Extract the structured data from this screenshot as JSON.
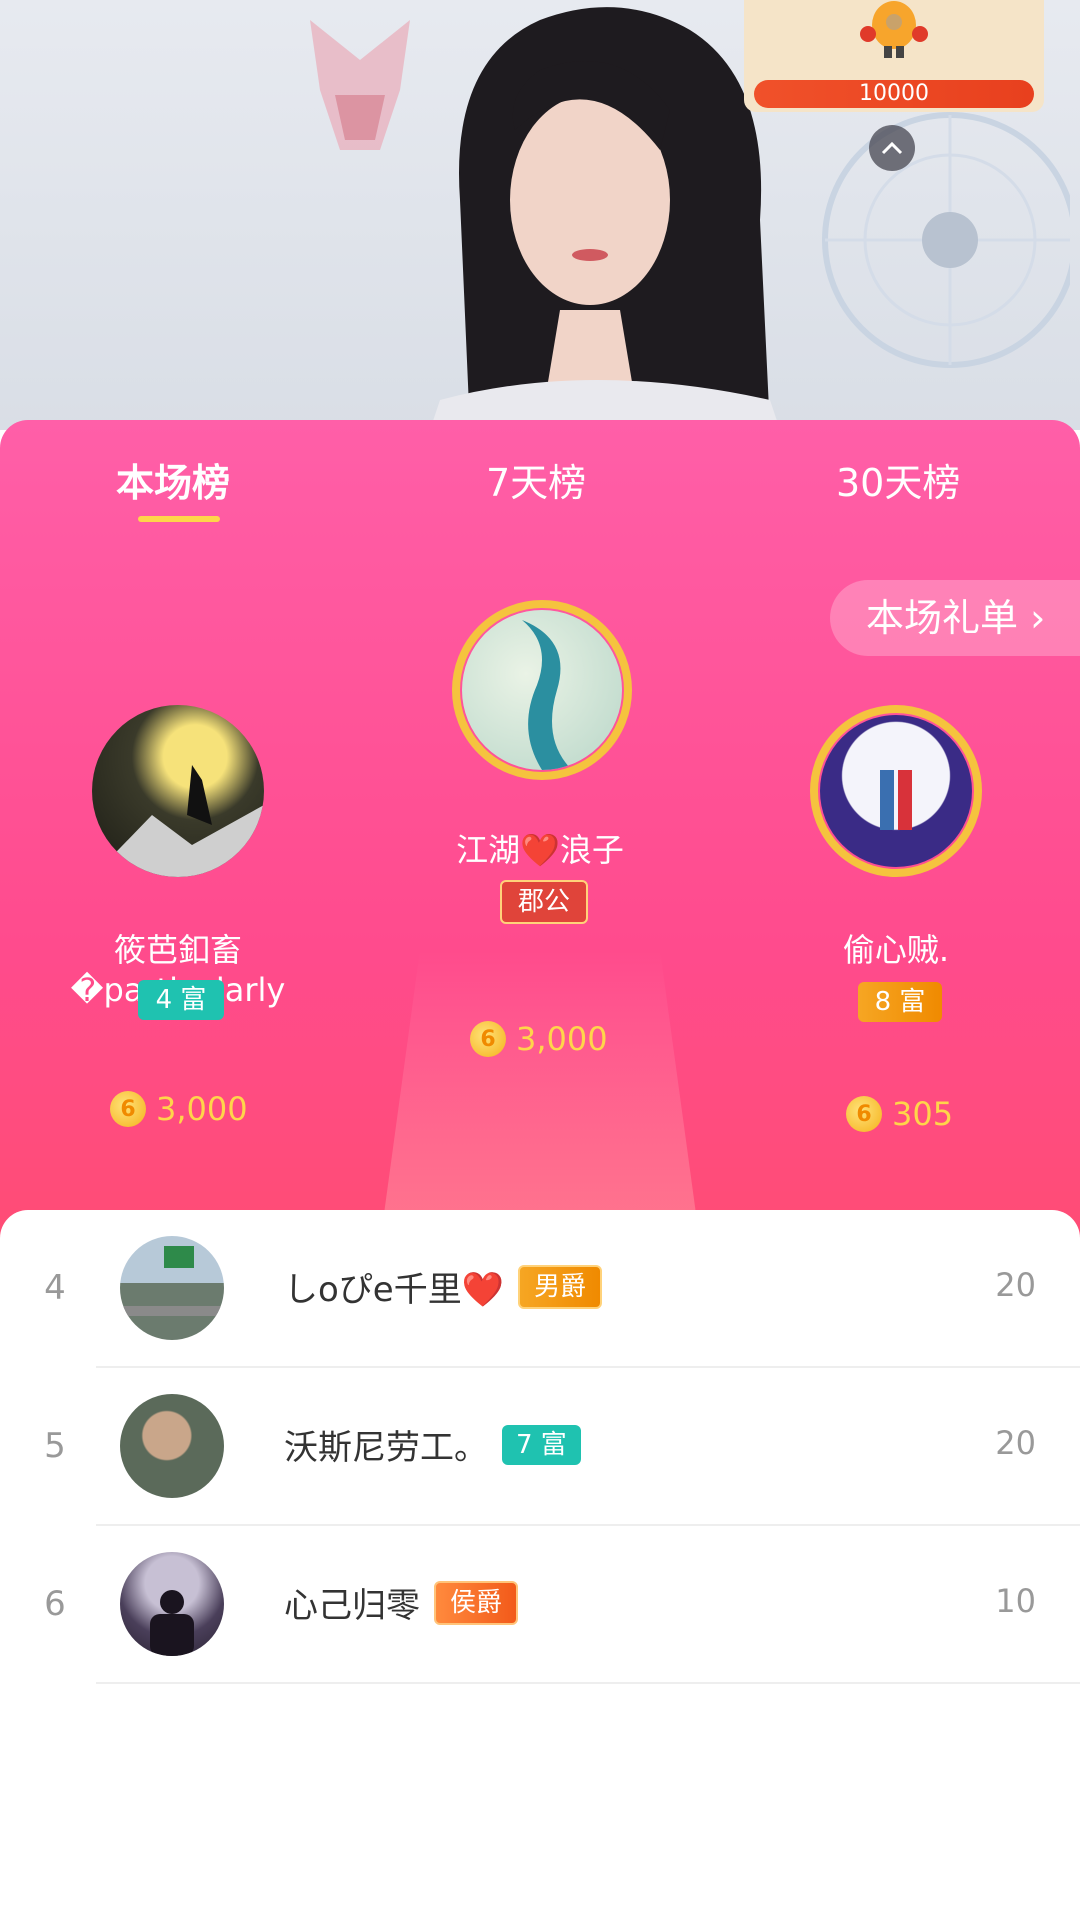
{
  "gift_card": {
    "amount": "10000"
  },
  "tabs": [
    {
      "label": "本场榜",
      "active": true
    },
    {
      "label": "7天榜",
      "active": false
    },
    {
      "label": "30天榜",
      "active": false
    }
  ],
  "gift_list_button": {
    "label": "本场礼单 ›"
  },
  "podium": {
    "first": {
      "name": "江湖❤️浪子",
      "badge": "郡公",
      "score": "3,000"
    },
    "second": {
      "name": "筱芭釦畜�particularly",
      "badge": "4 富",
      "score": "3,000"
    },
    "third": {
      "name": "偷心贼.",
      "badge": "8 富",
      "score": "305"
    }
  },
  "list": [
    {
      "rank": "4",
      "name": "しoぴe千里❤️",
      "tag": "男爵",
      "tag_style": "gold",
      "score": "20"
    },
    {
      "rank": "5",
      "name": "沃斯尼劳工。",
      "tag": "7 富",
      "tag_style": "teal",
      "score": "20"
    },
    {
      "rank": "6",
      "name": "心己归零",
      "tag": "侯爵",
      "tag_style": "orange",
      "score": "10"
    }
  ],
  "colors": {
    "panel_pink": "#ff4b8d",
    "accent_yellow": "#ffd54a",
    "teal_badge": "#1fc2b0",
    "gold_badge": "#f6a623"
  },
  "icons": {
    "coin": "coin-icon",
    "collapse": "chevron-up-icon"
  }
}
